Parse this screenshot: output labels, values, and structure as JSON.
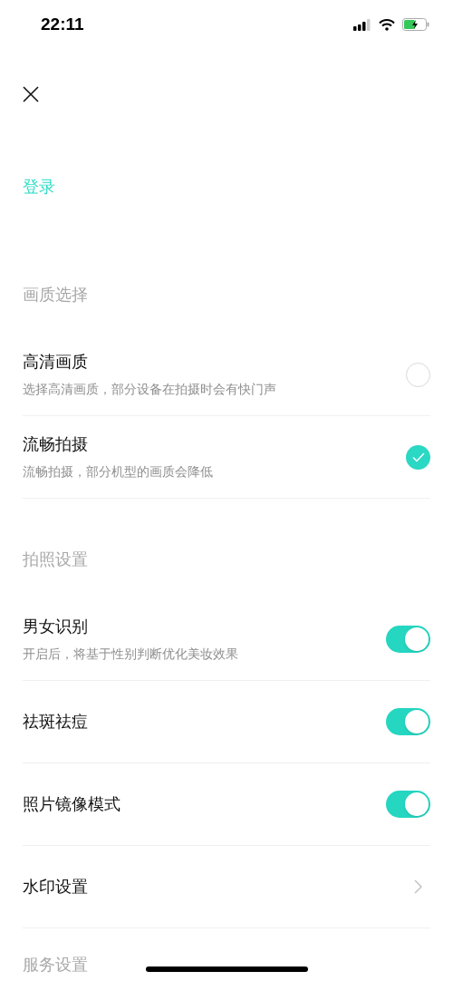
{
  "status_bar": {
    "time": "22:11"
  },
  "login_link": "登录",
  "sections": [
    {
      "title": "画质选择",
      "items": [
        {
          "kind": "radio",
          "title": "高清画质",
          "subtitle": "选择高清画质，部分设备在拍摄时会有快门声",
          "selected": false
        },
        {
          "kind": "radio",
          "title": "流畅拍摄",
          "subtitle": "流畅拍摄，部分机型的画质会降低",
          "selected": true
        }
      ]
    },
    {
      "title": "拍照设置",
      "items": [
        {
          "kind": "toggle",
          "title": "男女识别",
          "subtitle": "开启后，将基于性别判断优化美妆效果",
          "on": true
        },
        {
          "kind": "toggle",
          "title": "祛斑祛痘",
          "on": true
        },
        {
          "kind": "toggle",
          "title": "照片镜像模式",
          "on": true
        },
        {
          "kind": "link",
          "title": "水印设置"
        }
      ]
    },
    {
      "title": "服务设置"
    }
  ]
}
